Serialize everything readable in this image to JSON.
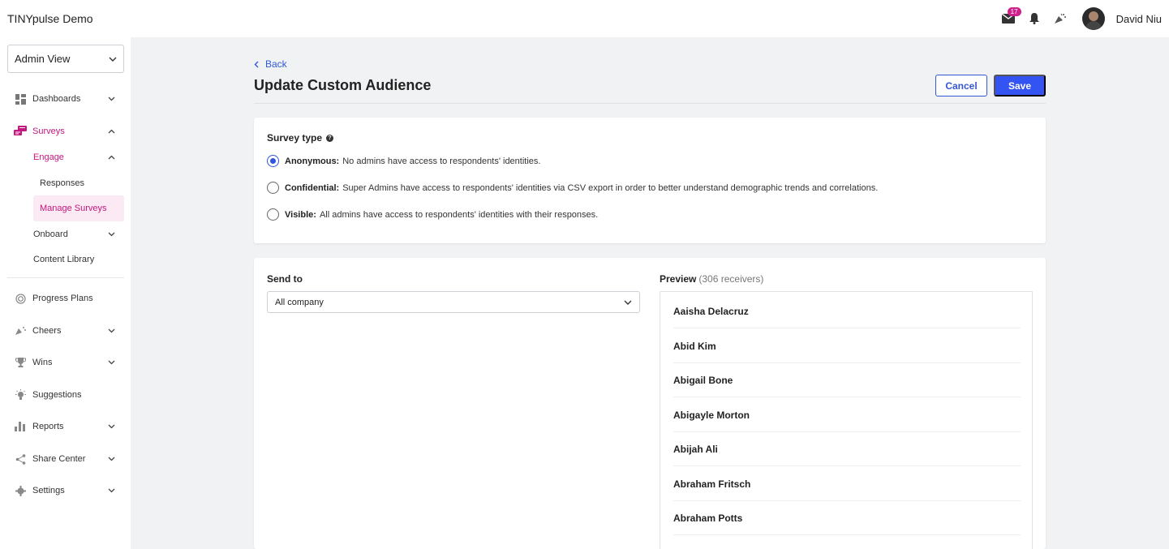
{
  "app": {
    "title": "TINYpulse Demo"
  },
  "topbar": {
    "mail_count": "17",
    "user_name": "David Niu"
  },
  "sidebar": {
    "view_select": "Admin View",
    "items": [
      {
        "label": "Dashboards",
        "icon": "dashboard-icon"
      },
      {
        "label": "Surveys",
        "icon": "surveys-icon"
      },
      {
        "label": "Engage"
      },
      {
        "label": "Responses"
      },
      {
        "label": "Manage Surveys"
      },
      {
        "label": "Onboard"
      },
      {
        "label": "Content Library"
      },
      {
        "label": "Progress Plans",
        "icon": "target-icon"
      },
      {
        "label": "Cheers",
        "icon": "cheers-icon"
      },
      {
        "label": "Wins",
        "icon": "trophy-icon"
      },
      {
        "label": "Suggestions",
        "icon": "lightbulb-icon"
      },
      {
        "label": "Reports",
        "icon": "bar-chart-icon"
      },
      {
        "label": "Share Center",
        "icon": "share-icon"
      },
      {
        "label": "Settings",
        "icon": "gear-icon"
      }
    ]
  },
  "main": {
    "back_label": "Back",
    "title": "Update Custom Audience",
    "cancel_label": "Cancel",
    "save_label": "Save",
    "survey_type": {
      "label": "Survey type",
      "options": [
        {
          "title": "Anonymous:",
          "desc": "No admins have access to respondents' identities.",
          "checked": true
        },
        {
          "title": "Confidential:",
          "desc": "Super Admins have access to respondents' identities via CSV export in order to better understand demographic trends and correlations.",
          "checked": false
        },
        {
          "title": "Visible:",
          "desc": "All admins have access to respondents' identities with their responses.",
          "checked": false
        }
      ]
    },
    "send_to": {
      "label": "Send to",
      "value": "All company"
    },
    "preview": {
      "label": "Preview",
      "count": "(306 receivers)",
      "names": [
        "Aaisha Delacruz",
        "Abid Kim",
        "Abigail Bone",
        "Abigayle Morton",
        "Abijah Ali",
        "Abraham Fritsch",
        "Abraham Potts"
      ]
    }
  },
  "colors": {
    "accent": "#c3187f",
    "primary": "#3353f3",
    "link": "#2e5cd9"
  }
}
